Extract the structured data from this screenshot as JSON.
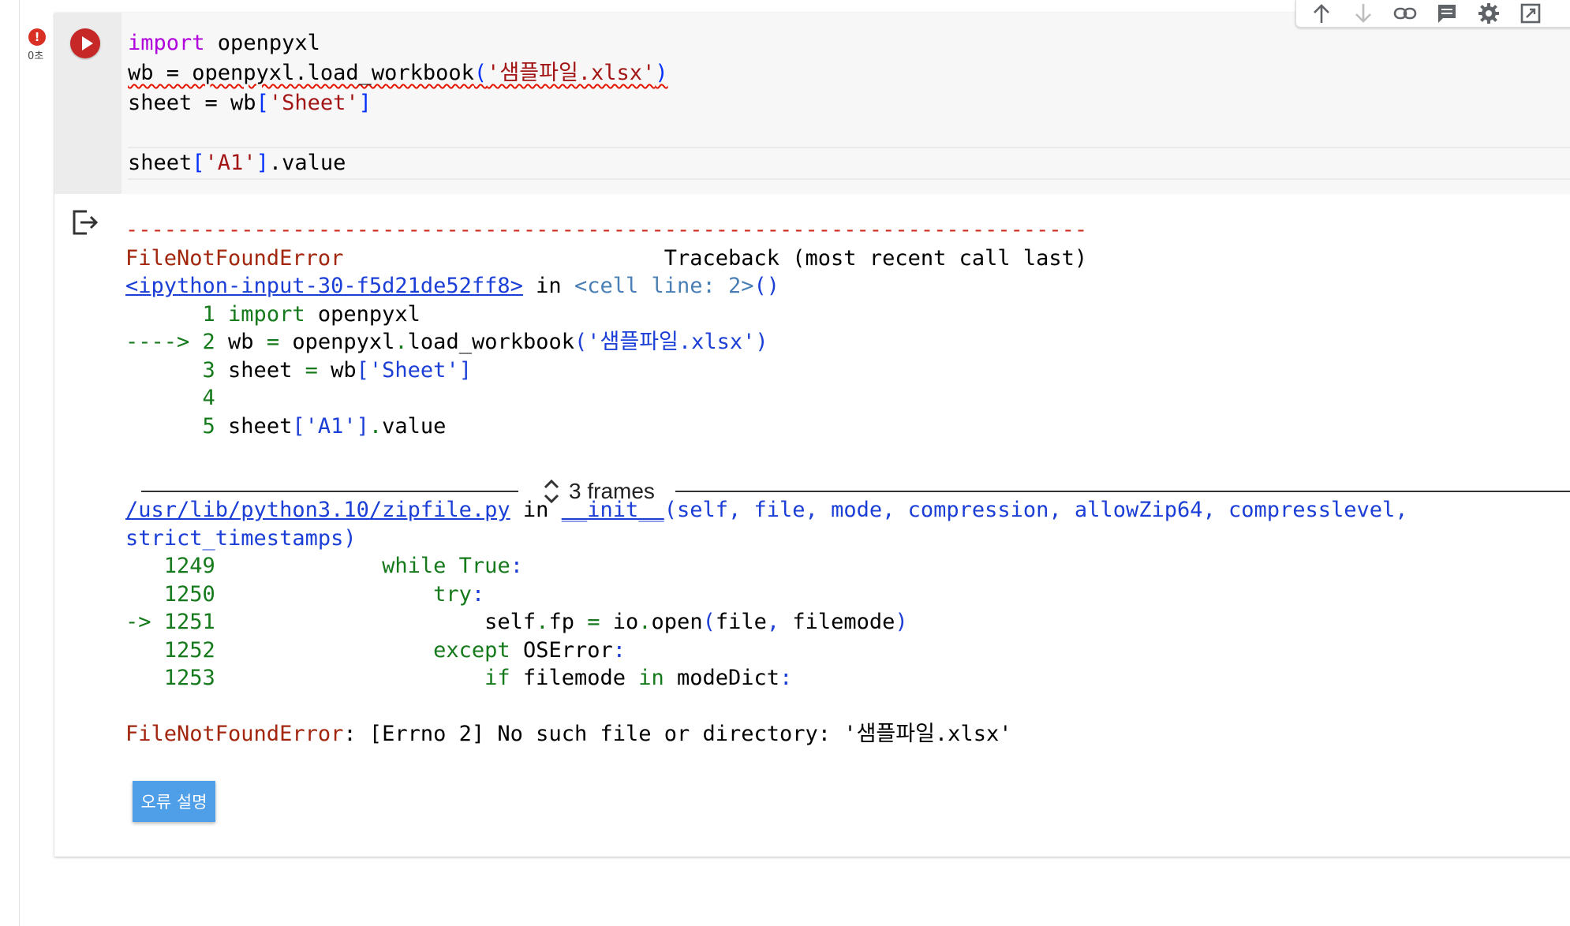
{
  "status": {
    "error_icon": "!",
    "exec_time": "0초"
  },
  "toolbar": {
    "icons": [
      "arrow-up-icon",
      "arrow-down-icon",
      "link-icon",
      "comment-icon",
      "gear-icon",
      "mirror-cell-icon",
      "more-icon"
    ]
  },
  "code": {
    "l1_kw": "import",
    "l1_rest": " openpyxl",
    "l2_a": "wb = openpyxl.load_workbook",
    "l2_open": "(",
    "l2_str": "'샘플파일.xlsx'",
    "l2_close": ")",
    "l3_a": "sheet = wb",
    "l3_open": "[",
    "l3_str": "'Sheet'",
    "l3_close": "]",
    "l5_a": "sheet",
    "l5_open": "[",
    "l5_str": "'A1'",
    "l5_close": "]",
    "l5_rest": ".value"
  },
  "output": {
    "dashes": "---------------------------------------------------------------------------",
    "error_name": "FileNotFoundError",
    "traceback_label": "                         Traceback (most recent call last)",
    "input_link": "<ipython-input-30-f5d21de52ff8>",
    "in_word": " in ",
    "cell_ref": "<cell line: 2>",
    "cell_ref_parens": "()",
    "src": [
      {
        "prefix": "      1 ",
        "parts": [
          {
            "c": "grn",
            "t": "import"
          },
          {
            "c": "",
            "t": " openpyxl"
          }
        ]
      },
      {
        "prefix": "----> 2 ",
        "parts": [
          {
            "c": "",
            "t": "wb "
          },
          {
            "c": "grn",
            "t": "="
          },
          {
            "c": "",
            "t": " openpyxl"
          },
          {
            "c": "grn",
            "t": "."
          },
          {
            "c": "",
            "t": "load_workbook"
          },
          {
            "c": "blu",
            "t": "("
          },
          {
            "c": "blu",
            "t": "'샘플파일.xlsx'"
          },
          {
            "c": "blu",
            "t": ")"
          }
        ]
      },
      {
        "prefix": "      3 ",
        "parts": [
          {
            "c": "",
            "t": "sheet "
          },
          {
            "c": "grn",
            "t": "="
          },
          {
            "c": "",
            "t": " wb"
          },
          {
            "c": "blu",
            "t": "["
          },
          {
            "c": "blu",
            "t": "'Sheet'"
          },
          {
            "c": "blu",
            "t": "]"
          }
        ]
      },
      {
        "prefix": "      4",
        "parts": []
      },
      {
        "prefix": "      5 ",
        "parts": [
          {
            "c": "",
            "t": "sheet"
          },
          {
            "c": "blu",
            "t": "["
          },
          {
            "c": "blu",
            "t": "'A1'"
          },
          {
            "c": "blu",
            "t": "]"
          },
          {
            "c": "grn",
            "t": "."
          },
          {
            "c": "",
            "t": "value"
          }
        ]
      }
    ],
    "frames_label": "3 frames",
    "zip_link": "/usr/lib/python3.10/zipfile.py",
    "zip_in": " in ",
    "init_name": "__init__",
    "init_args_1": "(self, file, mode, compression, allowZip64, compresslevel,",
    "init_args_2": "strict_timestamps)",
    "zip_src": [
      {
        "prefix": "   1249 ",
        "parts": [
          {
            "c": "",
            "t": "            "
          },
          {
            "c": "grn",
            "t": "while"
          },
          {
            "c": "",
            "t": " "
          },
          {
            "c": "grn",
            "t": "True"
          },
          {
            "c": "blu",
            "t": ":"
          }
        ]
      },
      {
        "prefix": "   1250 ",
        "parts": [
          {
            "c": "",
            "t": "                "
          },
          {
            "c": "grn",
            "t": "try"
          },
          {
            "c": "blu",
            "t": ":"
          }
        ]
      },
      {
        "prefix": "-> 1251 ",
        "parts": [
          {
            "c": "",
            "t": "                    self"
          },
          {
            "c": "grn",
            "t": "."
          },
          {
            "c": "",
            "t": "fp "
          },
          {
            "c": "grn",
            "t": "="
          },
          {
            "c": "",
            "t": " io"
          },
          {
            "c": "grn",
            "t": "."
          },
          {
            "c": "",
            "t": "open"
          },
          {
            "c": "blu",
            "t": "("
          },
          {
            "c": "",
            "t": "file"
          },
          {
            "c": "blu",
            "t": ","
          },
          {
            "c": "",
            "t": " filemode"
          },
          {
            "c": "blu",
            "t": ")"
          }
        ]
      },
      {
        "prefix": "   1252 ",
        "parts": [
          {
            "c": "",
            "t": "                "
          },
          {
            "c": "grn",
            "t": "except"
          },
          {
            "c": "",
            "t": " OSError"
          },
          {
            "c": "blu",
            "t": ":"
          }
        ]
      },
      {
        "prefix": "   1253 ",
        "parts": [
          {
            "c": "",
            "t": "                    "
          },
          {
            "c": "grn",
            "t": "if"
          },
          {
            "c": "",
            "t": " filemode "
          },
          {
            "c": "grn",
            "t": "in"
          },
          {
            "c": "",
            "t": " modeDict"
          },
          {
            "c": "blu",
            "t": ":"
          }
        ]
      }
    ],
    "final_error_name": "FileNotFoundError",
    "final_colon": ":",
    "final_message": " [Errno 2] No such file or directory: '샘플파일.xlsx'",
    "explain_button": "오류 설명"
  }
}
